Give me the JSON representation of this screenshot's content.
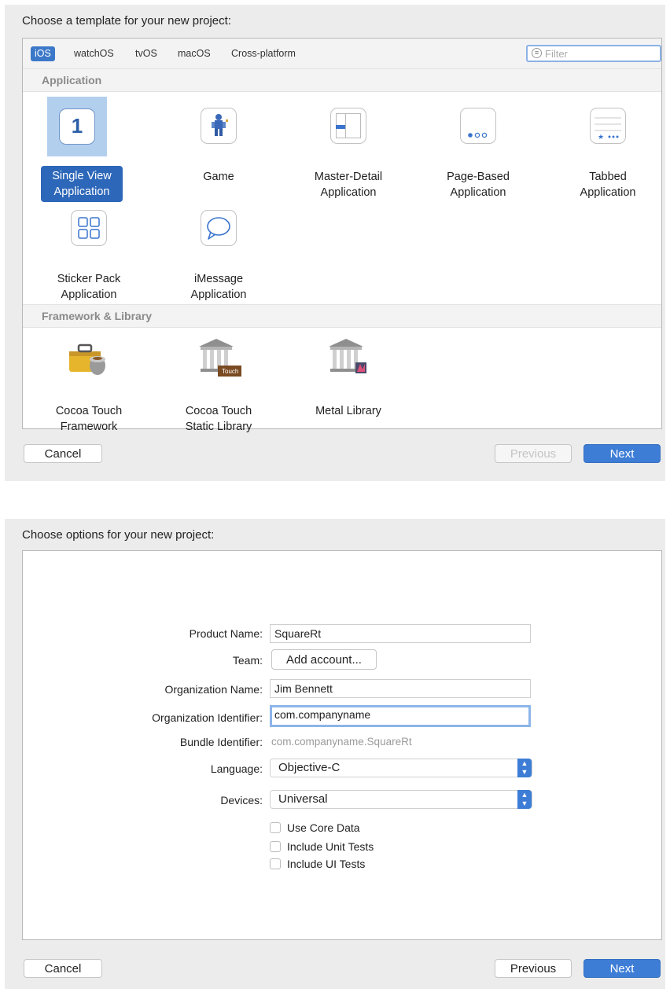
{
  "template_dialog": {
    "title": "Choose a template for your new project:",
    "tabs": [
      "iOS",
      "watchOS",
      "tvOS",
      "macOS",
      "Cross-platform"
    ],
    "active_tab": "iOS",
    "filter_placeholder": "Filter",
    "sections": [
      {
        "header": "Application",
        "items": [
          {
            "name": "Single View Application",
            "line1": "Single View",
            "line2": "Application",
            "icon": "single-view-icon",
            "selected": true
          },
          {
            "name": "Game",
            "line1": "Game",
            "line2": "",
            "icon": "game-icon"
          },
          {
            "name": "Master-Detail Application",
            "line1": "Master-Detail",
            "line2": "Application",
            "icon": "master-detail-icon"
          },
          {
            "name": "Page-Based Application",
            "line1": "Page-Based",
            "line2": "Application",
            "icon": "page-based-icon"
          },
          {
            "name": "Tabbed Application",
            "line1": "Tabbed",
            "line2": "Application",
            "icon": "tabbed-icon"
          },
          {
            "name": "Sticker Pack Application",
            "line1": "Sticker Pack",
            "line2": "Application",
            "icon": "sticker-pack-icon"
          },
          {
            "name": "iMessage Application",
            "line1": "iMessage",
            "line2": "Application",
            "icon": "imessage-icon"
          }
        ]
      },
      {
        "header": "Framework & Library",
        "items": [
          {
            "name": "Cocoa Touch Framework",
            "line1": "Cocoa Touch",
            "line2": "Framework",
            "icon": "toolbox-icon"
          },
          {
            "name": "Cocoa Touch Static Library",
            "line1": "Cocoa Touch",
            "line2": "Static Library",
            "icon": "library-building-icon",
            "badge": "Touch"
          },
          {
            "name": "Metal Library",
            "line1": "Metal Library",
            "line2": "",
            "icon": "metal-library-icon"
          }
        ]
      }
    ],
    "buttons": {
      "cancel": "Cancel",
      "previous": "Previous",
      "next": "Next"
    }
  },
  "options_dialog": {
    "title": "Choose options for your new project:",
    "fields": {
      "product_name": {
        "label": "Product Name:",
        "value": "SquareRt"
      },
      "team": {
        "label": "Team:",
        "button": "Add account..."
      },
      "organization_name": {
        "label": "Organization Name:",
        "value": "Jim Bennett"
      },
      "organization_identifier": {
        "label": "Organization Identifier:",
        "value": "com.companyname"
      },
      "bundle_identifier": {
        "label": "Bundle Identifier:",
        "value": "com.companyname.SquareRt"
      },
      "language": {
        "label": "Language:",
        "value": "Objective-C"
      },
      "devices": {
        "label": "Devices:",
        "value": "Universal"
      }
    },
    "checkboxes": [
      {
        "label": "Use Core Data",
        "checked": false
      },
      {
        "label": "Include Unit Tests",
        "checked": false
      },
      {
        "label": "Include UI Tests",
        "checked": false
      }
    ],
    "buttons": {
      "cancel": "Cancel",
      "previous": "Previous",
      "next": "Next"
    }
  },
  "colors": {
    "accent": "#3d7dd6",
    "selection": "#2d67b9",
    "selection_tile": "#b3cfee"
  }
}
